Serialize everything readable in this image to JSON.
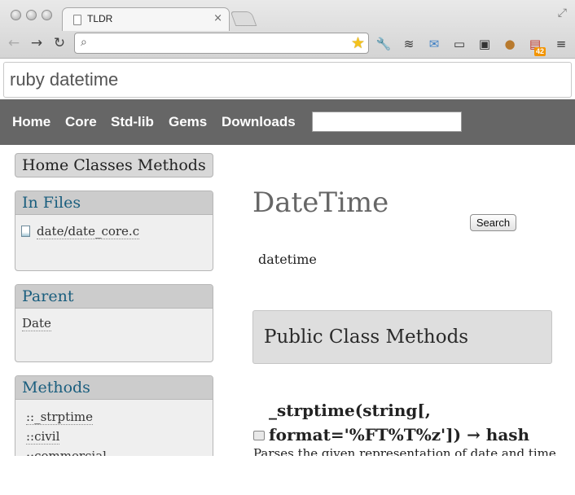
{
  "browser": {
    "tab_title": "TLDR",
    "tab_close": "×",
    "address_value": "",
    "nav": {
      "back": "←",
      "forward": "→",
      "reload": "↻"
    },
    "extensions": [
      "wrench-icon",
      "layers-icon",
      "mail-icon",
      "screen-capture-icon",
      "evernote-icon",
      "cookie-icon",
      "mailbox-icon"
    ],
    "extension_badge": "42",
    "star": "★",
    "search_glyph": "⌕"
  },
  "page": {
    "query": "ruby datetime",
    "nav_links": [
      "Home",
      "Core",
      "Std-lib",
      "Gems",
      "Downloads"
    ],
    "search_value": "",
    "search_button": "Search",
    "breadcrumb": "Home Classes Methods",
    "in_files": {
      "title": "In Files",
      "files": [
        "date/date_core.c"
      ]
    },
    "parent": {
      "title": "Parent",
      "value": "Date"
    },
    "methods": {
      "title": "Methods",
      "items": [
        "::_strptime",
        "::civil",
        "::commercial"
      ]
    },
    "class_title": "DateTime",
    "class_desc": "datetime",
    "section_title": "Public Class Methods",
    "method_signature": "_strptime(string[, format='%FT%T%z']) → hash",
    "method_desc": "Parses the given representation of date and time"
  },
  "colors": {
    "navbar_bg": "#666666",
    "sidebar_header_bg": "#cccccc",
    "sidebar_header_text": "#1a5e7e",
    "section_bg": "#dedede"
  }
}
